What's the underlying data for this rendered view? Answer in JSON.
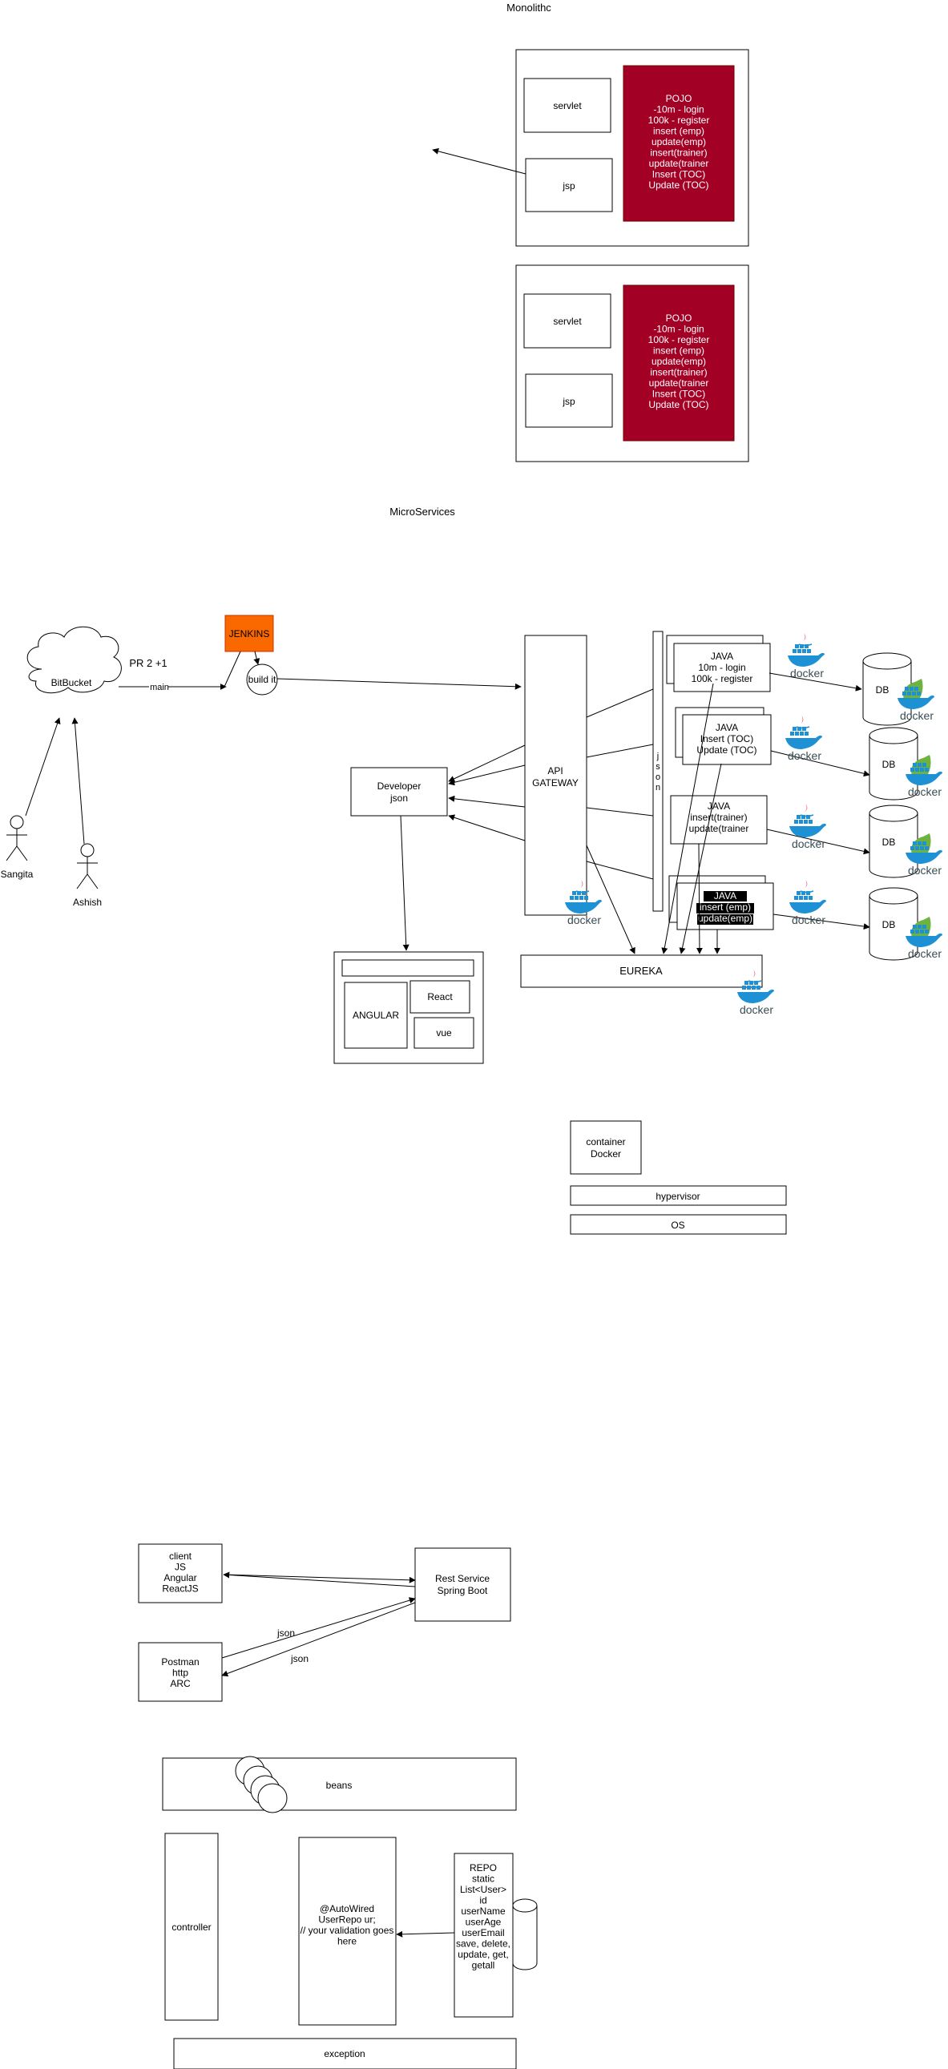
{
  "titles": {
    "monolith": "Monolithc",
    "micro": "MicroServices"
  },
  "colors": {
    "pojo": "#a20025",
    "jenkins": "#fa6800",
    "docker": "#1d91d3",
    "java_red": "#e4002b",
    "line": "#000000"
  },
  "mono1": {
    "servlet": "servlet",
    "jsp": "jsp",
    "pojo": [
      "POJO",
      "-10m - login",
      "100k - register",
      "insert (emp)",
      "update(emp)",
      "insert(trainer)",
      "update(trainer",
      "Insert (TOC)",
      "Update (TOC)"
    ]
  },
  "mono2": {
    "servlet": "servlet",
    "jsp": "jsp",
    "pojo": [
      "POJO",
      "-10m - login",
      "100k - register",
      "insert (emp)",
      "update(emp)",
      "insert(trainer)",
      "update(trainer",
      "Insert (TOC)",
      "Update (TOC)"
    ]
  },
  "bitbucket": "BitBucket",
  "pr_label": "PR 2 +1",
  "main_label": "main",
  "jenkins": "JENKINS",
  "build": "build it",
  "actors": {
    "a1": "Sangita",
    "a2": "Ashish"
  },
  "developer": [
    "Developer",
    "json"
  ],
  "ui_box": {
    "angular": "ANGULAR",
    "react": "React",
    "vue": "vue"
  },
  "gateway": [
    "API",
    "GATEWAY"
  ],
  "json_bar": "j\ns\no\nn",
  "services": [
    [
      "JAVA",
      "10m - login",
      "100k - register"
    ],
    [
      "JAVA",
      "Insert (TOC)",
      "Update (TOC)"
    ],
    [
      "JAVA",
      "insert(trainer)",
      "update(trainer"
    ],
    [
      "JAVA",
      "insert (emp)",
      "update(emp)"
    ]
  ],
  "db": "DB",
  "docker_word": "docker",
  "java_word": "java",
  "eureka": "EUREKA",
  "virt": {
    "container": [
      "container",
      "Docker"
    ],
    "hypervisor": "hypervisor",
    "os": "OS"
  },
  "client": [
    "client",
    "JS",
    "Angular",
    "ReactJS"
  ],
  "postman": [
    "Postman",
    "http",
    "ARC"
  ],
  "rest": [
    "Rest Service",
    "Spring Boot"
  ],
  "json_labels": [
    "json",
    "json"
  ],
  "beans": "beans",
  "controller": "controller",
  "autowired": [
    "@AutoWired",
    "UserRepo ur;",
    "",
    "// your validation goes",
    "here"
  ],
  "repo": [
    "REPO",
    "static",
    "",
    "List<User>",
    "id",
    "userName",
    "userAge",
    "userEmail",
    "",
    "",
    "save, delete,",
    "update, get,",
    "getall"
  ],
  "exception": "exception"
}
